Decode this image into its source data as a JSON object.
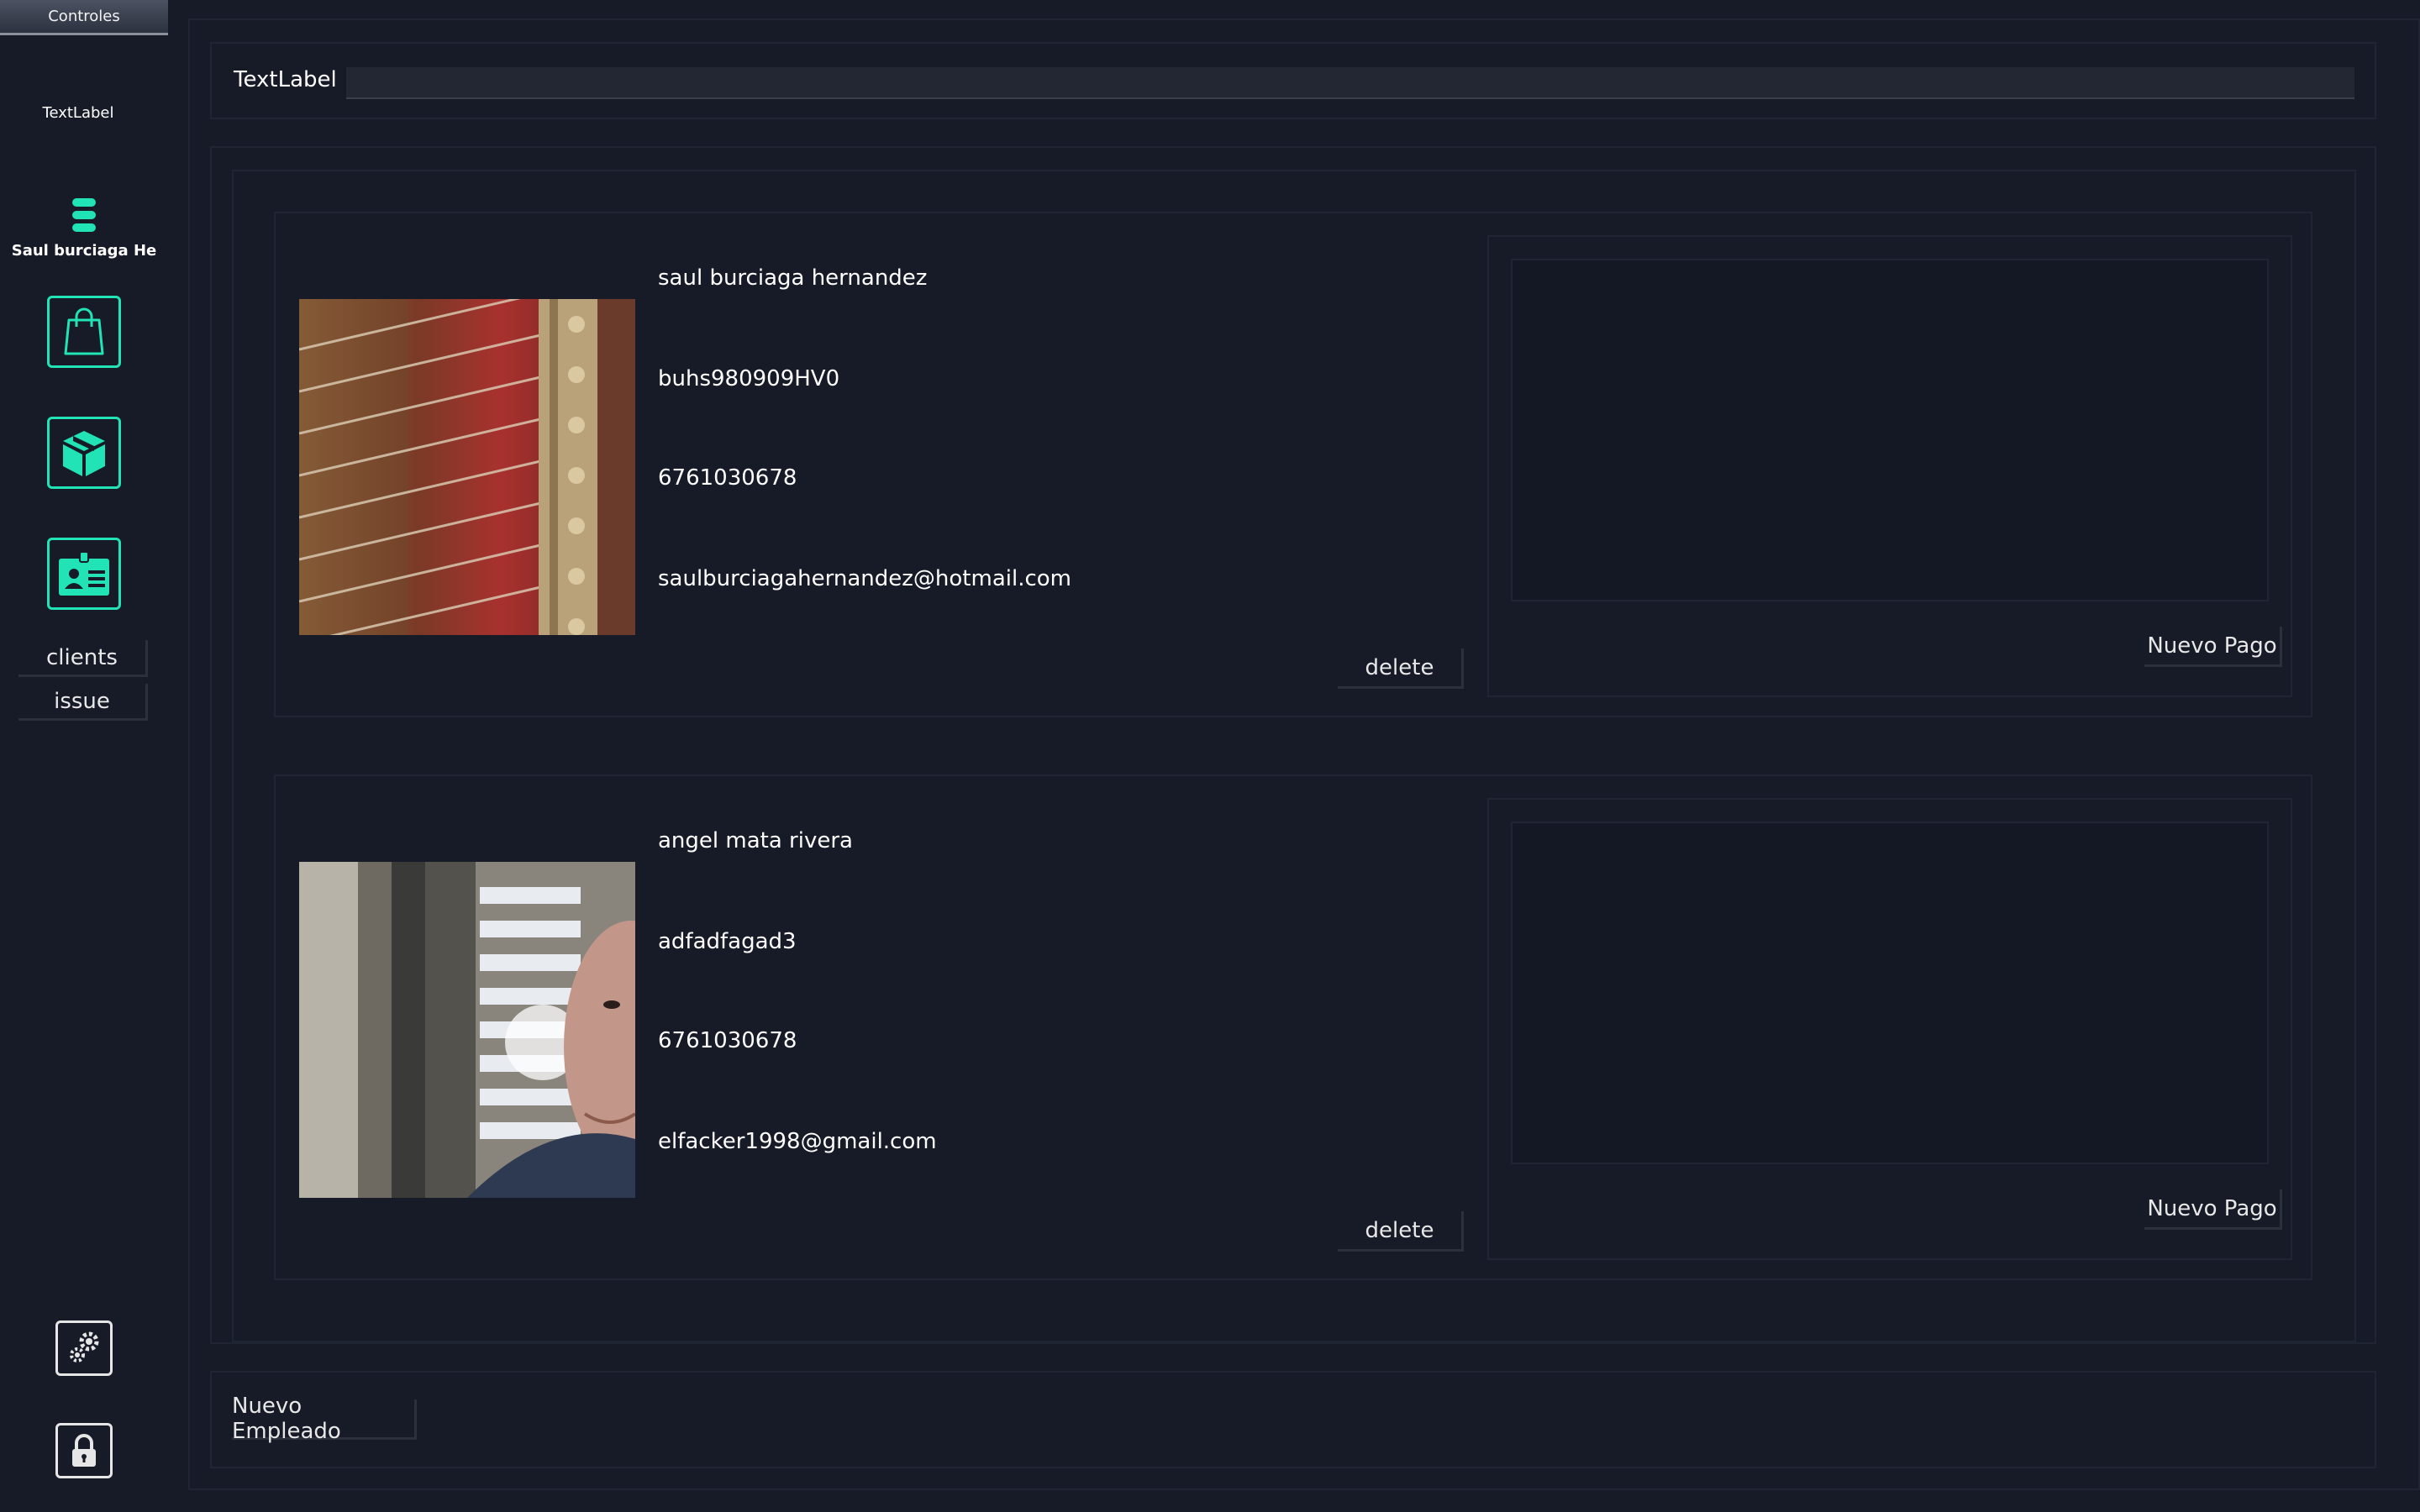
{
  "sidebar": {
    "header": "Controles",
    "text_label": "TextLabel",
    "user_name": "Saul burciaga He",
    "nav_icons": [
      "shopping-bag-icon",
      "package-box-icon",
      "id-card-icon"
    ],
    "buttons": {
      "clients": "clients",
      "issue": "issue"
    },
    "bottom_icons": [
      "settings-gears-icon",
      "lock-icon"
    ]
  },
  "main": {
    "label_row": {
      "label": "TextLabel",
      "value": ""
    },
    "cards": [
      {
        "name": "saul burciaga hernandez",
        "rfc": "buhs980909HV0",
        "phone": "6761030678",
        "email": "saulburciagahernandez@hotmail.com",
        "delete_label": "delete",
        "pay_label": "Nuevo Pago"
      },
      {
        "name": "angel mata rivera",
        "rfc": "adfadfagad3",
        "phone": "6761030678",
        "email": "elfacker1998@gmail.com",
        "delete_label": "delete",
        "pay_label": "Nuevo Pago"
      }
    ],
    "new_employee_label": "Nuevo Empleado"
  },
  "colors": {
    "background": "#161b27",
    "accent": "#22e3b6",
    "border": "#1f2533"
  }
}
